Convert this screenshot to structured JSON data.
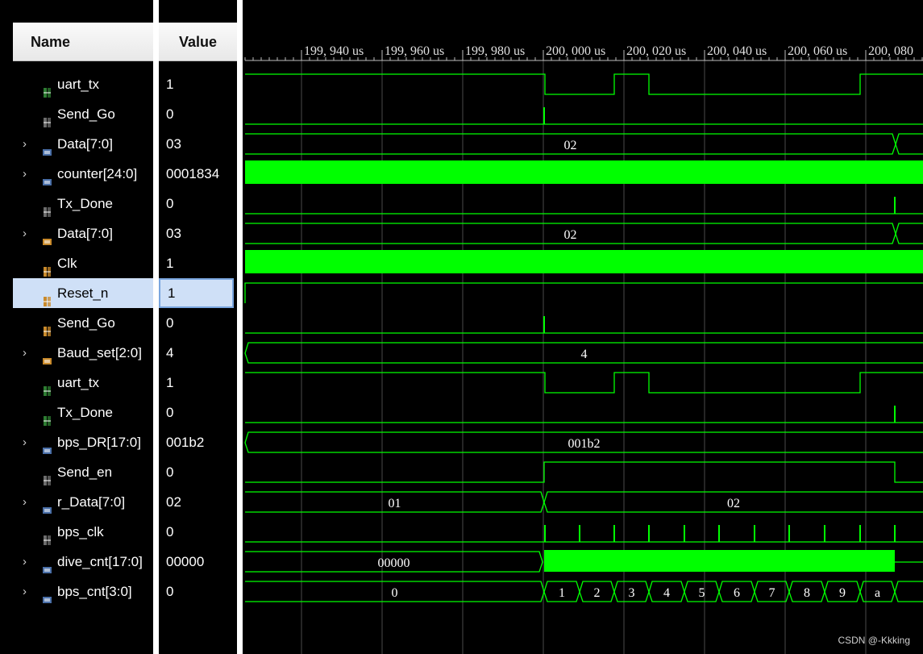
{
  "headers": {
    "name": "Name",
    "value": "Value"
  },
  "timeline": {
    "ticks": [
      "199, 940 us",
      "199, 960 us",
      "199, 980 us",
      "200, 000 us",
      "200, 020 us",
      "200, 040 us",
      "200, 060 us",
      "200, 080"
    ]
  },
  "signals": [
    {
      "name": "uart_tx",
      "value": "1",
      "expandable": false,
      "icon": "bit-signal-icon",
      "icon_color": "#2e7d32"
    },
    {
      "name": "Send_Go",
      "value": "0",
      "expandable": false,
      "icon": "bit-signal-icon",
      "icon_color": "#6d6d6d"
    },
    {
      "name": "Data[7:0]",
      "value": "03",
      "expandable": true,
      "icon": "bus-signal-icon",
      "icon_color": "#4a6fa8",
      "bus_labels": [
        "02"
      ]
    },
    {
      "name": "counter[24:0]",
      "value": "0001834",
      "expandable": true,
      "icon": "bus-signal-icon",
      "icon_color": "#4a6fa8"
    },
    {
      "name": "Tx_Done",
      "value": "0",
      "expandable": false,
      "icon": "bit-signal-icon",
      "icon_color": "#6d6d6d"
    },
    {
      "name": "Data[7:0]",
      "value": "03",
      "expandable": true,
      "icon": "bus-signal-icon",
      "icon_color": "#c98a2b",
      "bus_labels": [
        "02"
      ]
    },
    {
      "name": "Clk",
      "value": "1",
      "expandable": false,
      "icon": "bit-signal-icon",
      "icon_color": "#c98a2b"
    },
    {
      "name": "Reset_n",
      "value": "1",
      "expandable": false,
      "icon": "bit-signal-icon",
      "icon_color": "#c98a2b",
      "selected": true
    },
    {
      "name": "Send_Go",
      "value": "0",
      "expandable": false,
      "icon": "bit-signal-icon",
      "icon_color": "#c98a2b"
    },
    {
      "name": "Baud_set[2:0]",
      "value": "4",
      "expandable": true,
      "icon": "bus-signal-icon",
      "icon_color": "#c98a2b",
      "bus_labels": [
        "4"
      ]
    },
    {
      "name": "uart_tx",
      "value": "1",
      "expandable": false,
      "icon": "bit-signal-icon",
      "icon_color": "#2e7d32"
    },
    {
      "name": "Tx_Done",
      "value": "0",
      "expandable": false,
      "icon": "bit-signal-icon",
      "icon_color": "#2e7d32"
    },
    {
      "name": "bps_DR[17:0]",
      "value": "001b2",
      "expandable": true,
      "icon": "bus-signal-icon",
      "icon_color": "#4a6fa8",
      "bus_labels": [
        "001b2"
      ]
    },
    {
      "name": "Send_en",
      "value": "0",
      "expandable": false,
      "icon": "bit-signal-icon",
      "icon_color": "#6d6d6d"
    },
    {
      "name": "r_Data[7:0]",
      "value": "02",
      "expandable": true,
      "icon": "bus-signal-icon",
      "icon_color": "#4a6fa8",
      "bus_labels": [
        "01",
        "02"
      ]
    },
    {
      "name": "bps_clk",
      "value": "0",
      "expandable": false,
      "icon": "bit-signal-icon",
      "icon_color": "#6d6d6d"
    },
    {
      "name": "dive_cnt[17:0]",
      "value": "00000",
      "expandable": true,
      "icon": "bus-signal-icon",
      "icon_color": "#4a6fa8",
      "bus_labels": [
        "00000"
      ]
    },
    {
      "name": "bps_cnt[3:0]",
      "value": "0",
      "expandable": true,
      "icon": "bus-signal-icon",
      "icon_color": "#4a6fa8",
      "bus_labels": [
        "0",
        "1",
        "2",
        "3",
        "4",
        "5",
        "6",
        "7",
        "8",
        "9",
        "a"
      ]
    }
  ],
  "watermark": "CSDN @-Kkking",
  "colors": {
    "wave": "#00ff00",
    "grid": "#4a4a4a",
    "background": "#000000",
    "selection": "#cfe0f7"
  }
}
